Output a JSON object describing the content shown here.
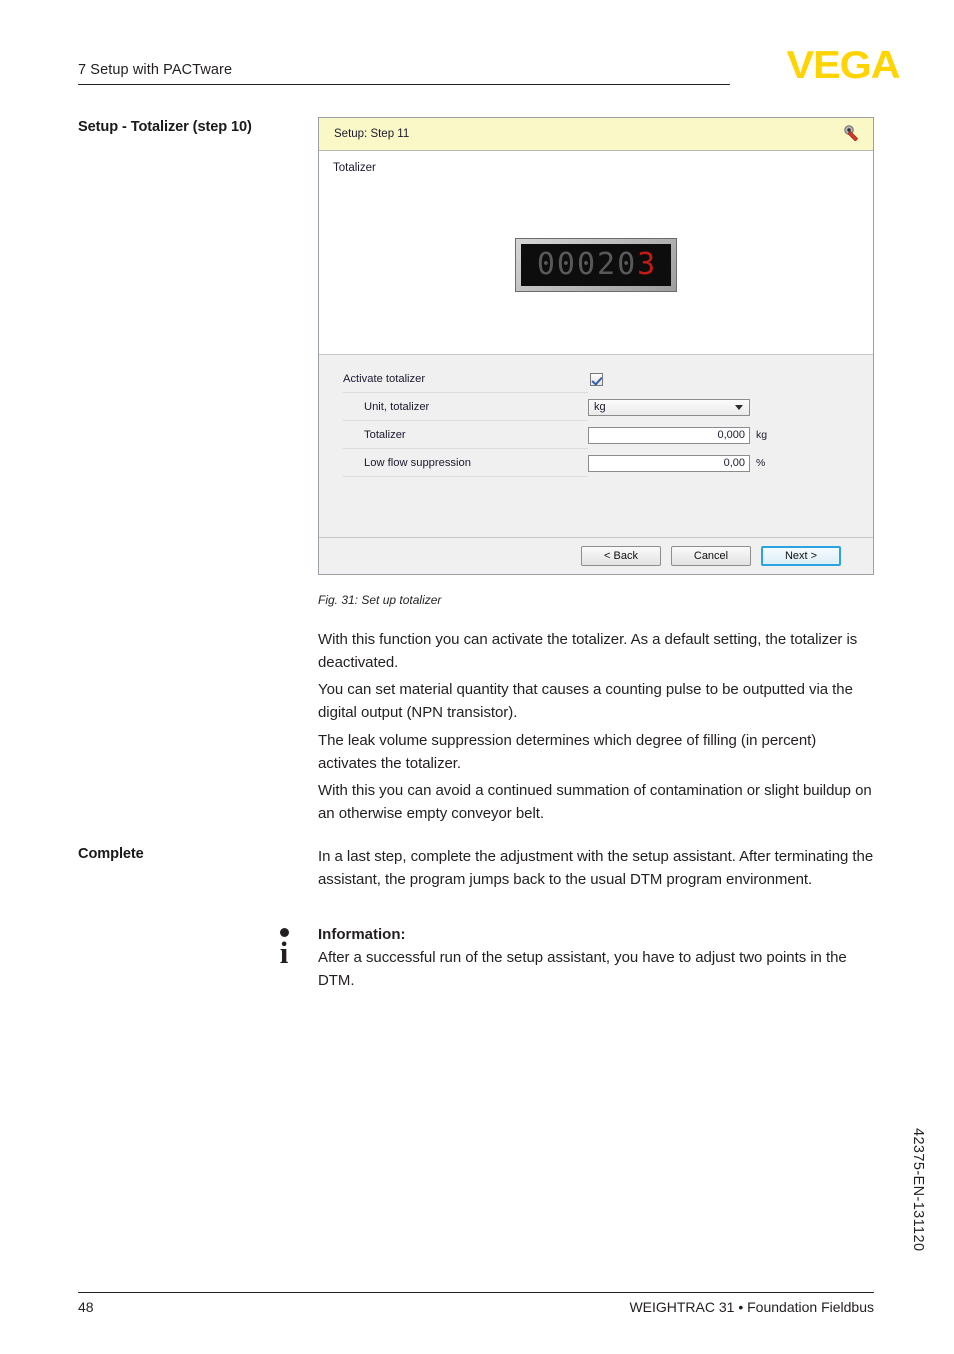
{
  "header": {
    "chapter": "7 Setup with PACTware",
    "logo": "VEGA"
  },
  "margin_labels": {
    "setup_totalizer": "Setup - Totalizer (step 10)",
    "complete": "Complete"
  },
  "dialog": {
    "title": "Setup: Step 11",
    "tool_icon": "wrench-icon",
    "section_label": "Totalizer",
    "display": {
      "digits": [
        "0",
        "0",
        "0",
        "2",
        "0",
        "3"
      ],
      "active_index": 5,
      "dim_color": "#595959",
      "active_color": "#c21a16"
    },
    "rows": [
      {
        "label": "Activate totalizer",
        "control": "checkbox",
        "checked": true,
        "unit": ""
      },
      {
        "label": "Unit, totalizer",
        "control": "combo",
        "value": "kg",
        "unit": ""
      },
      {
        "label": "Totalizer",
        "control": "textbox",
        "value": "0,000",
        "unit": "kg"
      },
      {
        "label": "Low flow suppression",
        "control": "textbox",
        "value": "0,00",
        "unit": "%"
      }
    ],
    "buttons": {
      "back": "< Back",
      "cancel": "Cancel",
      "next": "Next >",
      "accent": "#2aa3e0"
    }
  },
  "figure": {
    "caption": "Fig. 31: Set up totalizer"
  },
  "body": {
    "p1": "With this function you can activate the totalizer. As a default setting, the totalizer is deactivated.",
    "p2": "You can set material quantity that causes a counting pulse to be outputted via the digital output (NPN transistor).",
    "p3": "The leak volume suppression determines which degree of filling (in percent) activates the totalizer.",
    "p4": "With this you can avoid a continued summation of contamination or slight buildup on an otherwise empty conveyor belt.",
    "complete_text": "In a last step, complete the adjustment with the setup assistant. After terminating the assistant, the program jumps back to the usual DTM program environment."
  },
  "information": {
    "icon_letter": "i",
    "title": "Information:",
    "text": "After a successful run of the setup assistant, you have to adjust two points in the DTM."
  },
  "footer": {
    "page_number": "48",
    "document": "WEIGHTRAC 31 • Foundation Fieldbus",
    "side_code": "42375-EN-131120"
  }
}
